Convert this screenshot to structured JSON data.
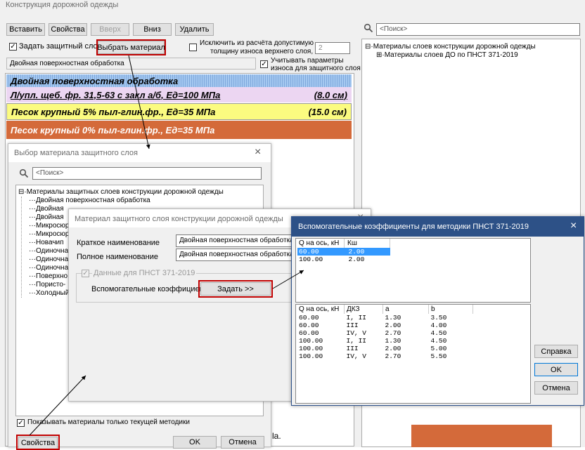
{
  "main": {
    "title": "Конструкция дорожной одежды",
    "toolbar": {
      "insert": "Вставить",
      "properties": "Свойства",
      "up": "Вверх",
      "down": "Вниз",
      "delete": "Удалить"
    },
    "protective_layer_label": "Задать защитный слой",
    "select_material": "Выбрать материал",
    "exclude_label_1": "Исключить из расчёта допустимую",
    "exclude_label_2": "толщину износа верхнего слоя, см",
    "exclude_value": "2",
    "wear_label_1": "Учитывать параметры",
    "wear_label_2": "износа для защитного слоя",
    "protective_material": "Двойная поверхностная обработка",
    "search_placeholder": "<Поиск>",
    "tree_root": "Материалы слоев конструкции дорожной одежды",
    "tree_child": "Материалы слоев ДО по ПНСТ 371-2019",
    "layers": [
      {
        "name": "Двойная поверхностная обработка",
        "thickness": "",
        "color": "#a4c8f0"
      },
      {
        "name": "Л/упл. щеб. фр. 31,5-63 с закл а/б, Ед=100 МПа",
        "thickness": "(8.0 см)",
        "color": "#ecd6f2"
      },
      {
        "name": "Песок крупный 5% пыл-глин.фр., Ед=35 МПа",
        "thickness": "(15.0 см)",
        "color": "#fbfb80"
      },
      {
        "name": "Песок крупный 0% пыл-глин.фр., Ед=35 МПа",
        "thickness": "",
        "color": "#d46a3a"
      }
    ],
    "fragment": "la."
  },
  "select_dialog": {
    "title": "Выбор материала защитного слоя",
    "search_placeholder": "<Поиск>",
    "tree_root": "Материалы защитных слоев конструкции дорожной одежды",
    "items": [
      "Двойная поверхностная обработка",
      "Двойная",
      "Двойная",
      "Микросюр",
      "Микросюр",
      "Новачип",
      "Одиночна",
      "Одиночна",
      "Одиночна",
      "Поверхно",
      "Пористо-",
      "Холодный"
    ],
    "show_only_current": "Показывать материалы только текущей методики",
    "properties": "Свойства",
    "ok": "OK",
    "cancel": "Отмена"
  },
  "material_dialog": {
    "title": "Материал защитного слоя конструкции дорожной одежды",
    "short_name_label": "Краткое наименование",
    "short_name_value": "Двойная поверхностная обработка",
    "full_name_label": "Полное наименование",
    "full_name_value": "Двойная поверхностная обработка",
    "pnst_group": "Данные для ПНСТ 371-2019",
    "coef_label": "Вспомогательные коэффициенты:",
    "set_button": "Задать >>"
  },
  "coef_dialog": {
    "title": "Вспомогательные коэффициенты для методики ПНСТ 371-2019",
    "table1": {
      "headers": [
        "Q на ось, кН",
        "Кш"
      ],
      "rows": [
        [
          "60.00",
          "2.00"
        ],
        [
          "100.00",
          "2.00"
        ]
      ]
    },
    "table2": {
      "headers": [
        "Q на ось, кН",
        "ДКЗ",
        "a",
        "b"
      ],
      "rows": [
        [
          "60.00",
          "I, II",
          "1.30",
          "3.50"
        ],
        [
          "60.00",
          "III",
          "2.00",
          "4.00"
        ],
        [
          "60.00",
          "IV, V",
          "2.70",
          "4.50"
        ],
        [
          "100.00",
          "I, II",
          "1.30",
          "4.50"
        ],
        [
          "100.00",
          "III",
          "2.00",
          "5.00"
        ],
        [
          "100.00",
          "IV, V",
          "2.70",
          "5.50"
        ]
      ]
    },
    "help": "Справка",
    "ok": "OK",
    "cancel": "Отмена"
  },
  "icons": {
    "close": "×",
    "search": "search-icon"
  }
}
